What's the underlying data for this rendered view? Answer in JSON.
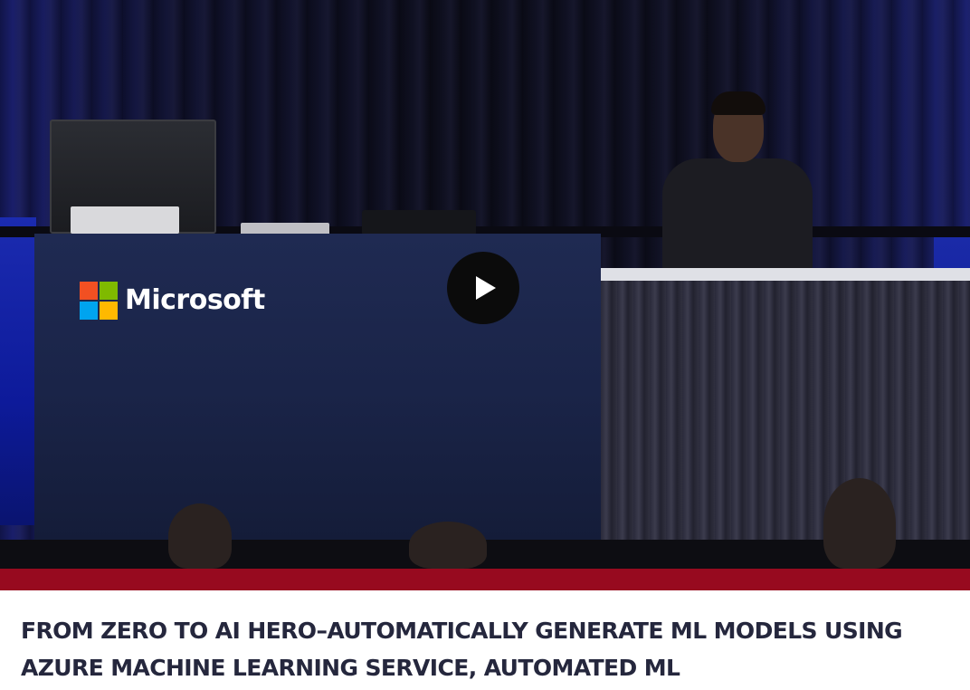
{
  "video": {
    "thumbnail_alt": "Presenter at Microsoft stage podium",
    "podium_brand": "Microsoft",
    "play_icon": "play-icon"
  },
  "colors": {
    "accent": "#970a1f",
    "title_text": "#25273d"
  },
  "session": {
    "title": "FROM ZERO TO AI HERO–AUTOMATICALLY GENERATE ML MODELS USING AZURE MACHINE LEARNING SERVICE, AUTOMATED ML"
  }
}
